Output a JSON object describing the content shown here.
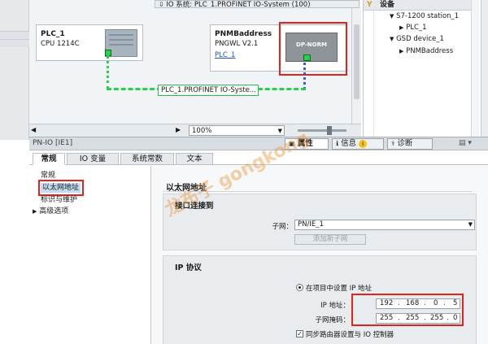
{
  "network_view": {
    "title": "IO 系统: PLC_1.PROFINET IO-System (100)",
    "plc": {
      "name": "PLC_1",
      "type": "CPU 1214C"
    },
    "device": {
      "name": "PNMBaddress",
      "type": "PNGWL V2.1",
      "link": "PLC_1",
      "module_label": "DP-NORM"
    },
    "network_label": "PLC_1.PROFINET IO-Syste...",
    "zoom": "100%"
  },
  "device_tree": {
    "header": "设备",
    "items": [
      {
        "label": "S7-1200 station_1",
        "indent": 1,
        "expanded": true
      },
      {
        "label": "PLC_1",
        "indent": 2,
        "expanded": false
      },
      {
        "label": "GSD device_1",
        "indent": 1,
        "expanded": true
      },
      {
        "label": "PNMBaddress",
        "indent": 2,
        "expanded": false
      }
    ]
  },
  "inspector": {
    "title": "PN-IO [IE1]",
    "tabs": {
      "properties": "属性",
      "info": "信息",
      "diagnostics": "诊断"
    },
    "subtabs": [
      "常规",
      "IO 变量",
      "系统常数",
      "文本"
    ],
    "nav": [
      "常规",
      "以太网地址",
      "标识与维护",
      "高级选项"
    ],
    "section_title": "以太网地址",
    "interface": {
      "title": "接口连接到",
      "subnet_label": "子网：",
      "subnet_value": "PN/IE_1",
      "add_button": "添加新子网"
    },
    "ip": {
      "title": "IP 协议",
      "option": "在项目中设置 IP 地址",
      "ip_label": "IP 地址：",
      "ip_octets": [
        "192",
        "168",
        "0",
        "5"
      ],
      "mask_label": "子网掩码：",
      "mask_octets": [
        "255",
        "255",
        "255",
        "0"
      ],
      "router_label": "同步路由器设置与 IO 控制器"
    }
  },
  "watermark": "龙布子 gongkong",
  "colors": {
    "highlight": "#e2231a",
    "network": "#29d14a",
    "nav_selected": "#c4dcf2"
  }
}
